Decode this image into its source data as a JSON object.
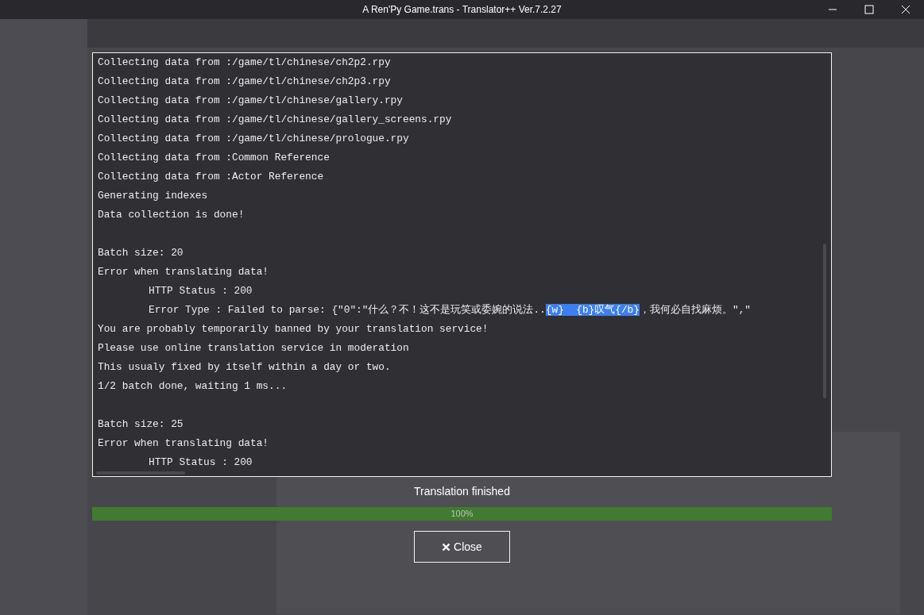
{
  "window": {
    "title": "A Ren'Py Game.trans - Translator++ Ver.7.2.27"
  },
  "log": {
    "lines": [
      {
        "kind": "text",
        "indented": false,
        "text": "Collecting data from :/game/tl/chinese/ch2p2.rpy"
      },
      {
        "kind": "text",
        "indented": false,
        "text": "Collecting data from :/game/tl/chinese/ch2p3.rpy"
      },
      {
        "kind": "text",
        "indented": false,
        "text": "Collecting data from :/game/tl/chinese/gallery.rpy"
      },
      {
        "kind": "text",
        "indented": false,
        "text": "Collecting data from :/game/tl/chinese/gallery_screens.rpy"
      },
      {
        "kind": "text",
        "indented": false,
        "text": "Collecting data from :/game/tl/chinese/prologue.rpy"
      },
      {
        "kind": "text",
        "indented": false,
        "text": "Collecting data from :Common Reference"
      },
      {
        "kind": "text",
        "indented": false,
        "text": "Collecting data from :Actor Reference"
      },
      {
        "kind": "text",
        "indented": false,
        "text": "Generating indexes"
      },
      {
        "kind": "text",
        "indented": false,
        "text": "Data collection is done!"
      },
      {
        "kind": "blank"
      },
      {
        "kind": "text",
        "indented": false,
        "text": "Batch size: 20"
      },
      {
        "kind": "text",
        "indented": false,
        "text": "Error when translating data!"
      },
      {
        "kind": "text",
        "indented": true,
        "text": "HTTP Status : 200"
      },
      {
        "kind": "segments",
        "indented": true,
        "segments": [
          {
            "text": "Error Type : Failed to parse: {\"0\":\"什么？不！这不是玩笑或委婉的说法..",
            "selected": false
          },
          {
            "text": "{w}  {b}叹气{/b}",
            "selected": true
          },
          {
            "text": "，我何必自找麻烦。\",\"",
            "selected": false
          }
        ]
      },
      {
        "kind": "text",
        "indented": false,
        "text": "You are probably temporarily banned by your translation service!"
      },
      {
        "kind": "text",
        "indented": false,
        "text": "Please use online translation service in moderation"
      },
      {
        "kind": "text",
        "indented": false,
        "text": "This usualy fixed by itself within a day or two."
      },
      {
        "kind": "text",
        "indented": false,
        "text": "1/2 batch done, waiting 1 ms..."
      },
      {
        "kind": "blank"
      },
      {
        "kind": "text",
        "indented": false,
        "text": "Batch size: 25"
      },
      {
        "kind": "text",
        "indented": false,
        "text": "Error when translating data!"
      },
      {
        "kind": "text",
        "indented": true,
        "text": "HTTP Status : 200"
      }
    ]
  },
  "status": "Translation finished",
  "progress": {
    "level": 1,
    "reading": "100%"
  },
  "close_button": {
    "label": "Close"
  }
}
